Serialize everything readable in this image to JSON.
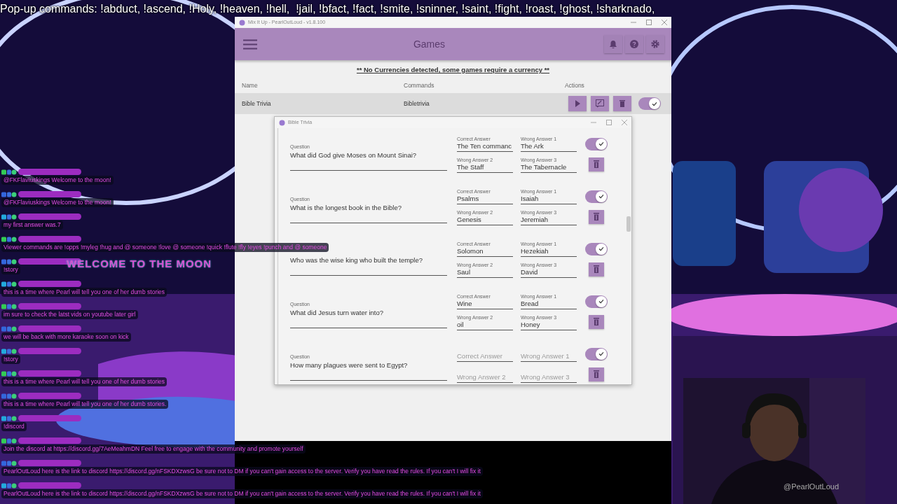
{
  "overlay_banner": "Pop-up commands: !abduct, !ascend, !Holy, !heaven, !hell,  !jail, !bfact, !fact, !smite, !sninner, !saint, !fight, !roast, !ghost, !sharknado,",
  "app": {
    "title": "Mix It Up - PearlOutLoud - v1.8.100",
    "header": "Games",
    "notice": "** No Currencies detected, some games require a currency **",
    "columns": [
      "Name",
      "Commands",
      "Actions"
    ],
    "games": [
      {
        "name": "Bible Trivia",
        "command": "Bibletrivia",
        "enabled": true
      }
    ]
  },
  "dialog": {
    "title": "Bible Trivia",
    "questions": [
      {
        "label": "Question",
        "text": "What did God give Moses on Mount Sinai?",
        "enabled": true,
        "answers": [
          {
            "label": "Correct Answer",
            "value": "The Ten commanc"
          },
          {
            "label": "Wrong Answer 1",
            "value": "The Ark"
          },
          {
            "label": "Wrong Answer 2",
            "value": "The Staff"
          },
          {
            "label": "Wrong Answer 3",
            "value": "The Tabernacle"
          }
        ]
      },
      {
        "label": "Question",
        "text": "What is the longest book in the Bible?",
        "enabled": true,
        "answers": [
          {
            "label": "Correct Answer",
            "value": "Psalms"
          },
          {
            "label": "Wrong Answer 1",
            "value": "Isaiah"
          },
          {
            "label": "Wrong Answer 2",
            "value": "Genesis"
          },
          {
            "label": "Wrong Answer 3",
            "value": "Jeremiah"
          }
        ]
      },
      {
        "text": "Who was the wise king who built the temple?",
        "enabled": true,
        "answers": [
          {
            "label": "Correct Answer",
            "value": "Solomon"
          },
          {
            "label": "Wrong Answer 1",
            "value": "Hezekiah"
          },
          {
            "label": "Wrong Answer 2",
            "value": "Saul"
          },
          {
            "label": "Wrong Answer 3",
            "value": "David"
          }
        ]
      },
      {
        "label": "Question",
        "text": "What did Jesus turn water into?",
        "enabled": true,
        "answers": [
          {
            "label": "Correct Answer",
            "value": "Wine"
          },
          {
            "label": "Wrong Answer 1",
            "value": "Bread"
          },
          {
            "label": "Wrong Answer 2",
            "value": "oil"
          },
          {
            "label": "Wrong Answer 3",
            "value": "Honey"
          }
        ]
      },
      {
        "label": "Question",
        "text": "How many plagues were sent to Egypt?",
        "enabled": true,
        "answers": [
          {
            "placeholder": "Correct Answer"
          },
          {
            "placeholder": "Wrong Answer 1"
          },
          {
            "placeholder": "Wrong Answer 2"
          },
          {
            "placeholder": "Wrong Answer 3"
          }
        ]
      }
    ]
  },
  "chat": {
    "logo": "WELCOME TO THE MOON",
    "messages": [
      {
        "text": "@FKFlaviuskings Welcome to the moon!"
      },
      {
        "text": "@FKFlaviuskings Welcome to the moon!"
      },
      {
        "text": "my first answer was.7"
      },
      {
        "text": "Viewer commands are !opps !myleg !hug and @ someone !love @ someone !quick !flute !fly !eyes !punch and @ someone"
      },
      {
        "text": "!story"
      },
      {
        "text": "this is a time where Pearl will tell you one of her dumb stories"
      },
      {
        "text": "im sure to check the latst vids on youtube later girl"
      },
      {
        "text": "we will be back with more karaoke soon on kick"
      },
      {
        "text": "!story"
      },
      {
        "text": "this is a time where Pearl will tell you one of her dumb stories"
      },
      {
        "text": "this is a time where Pearl will tell you one of her dumb stories."
      },
      {
        "text": "!discord"
      },
      {
        "text": "Join the discord at https://discord.gg/7AeMeahmDN Feel free to engage with the community and promote yourself"
      },
      {
        "text": "PearlOutLoud here is the link to discord https://discord.gg/nFSKDXzwsG be sure not to DM if you can't gain access to the server. Verify you have read the rules. If you can't I will fix it"
      },
      {
        "text": "PearlOutLoud here is the link to discord https://discord.gg/nFSKDXzwsG be sure not to DM if you can't gain access to the server. Verify you have read the rules. If you can't I will fix it"
      }
    ]
  },
  "handle": "@PearlOutLoud"
}
